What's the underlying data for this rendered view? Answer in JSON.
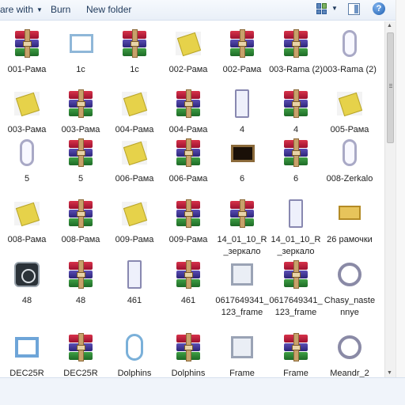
{
  "toolbar": {
    "share_label": "are with",
    "burn_label": "Burn",
    "new_folder_label": "New folder",
    "help_glyph": "?"
  },
  "files": [
    {
      "label": "001-Рама",
      "icon": "archive-icon"
    },
    {
      "label": "1c",
      "icon": "image-icon"
    },
    {
      "label": "1c",
      "icon": "archive-icon"
    },
    {
      "label": "002-Рама",
      "icon": "image-icon"
    },
    {
      "label": "002-Рама",
      "icon": "archive-icon"
    },
    {
      "label": "003-Rama (2)",
      "icon": "archive-icon"
    },
    {
      "label": "003-Rama (2)",
      "icon": "image-icon"
    },
    {
      "label": "003-Рама",
      "icon": "image-icon"
    },
    {
      "label": "003-Рама",
      "icon": "archive-icon"
    },
    {
      "label": "004-Рама",
      "icon": "image-icon"
    },
    {
      "label": "004-Рама",
      "icon": "archive-icon"
    },
    {
      "label": "4",
      "icon": "image-icon"
    },
    {
      "label": "4",
      "icon": "archive-icon"
    },
    {
      "label": "005-Рама",
      "icon": "image-icon"
    },
    {
      "label": "5",
      "icon": "image-icon"
    },
    {
      "label": "5",
      "icon": "archive-icon"
    },
    {
      "label": "006-Рама",
      "icon": "image-icon"
    },
    {
      "label": "006-Рама",
      "icon": "archive-icon"
    },
    {
      "label": "6",
      "icon": "image-icon"
    },
    {
      "label": "6",
      "icon": "archive-icon"
    },
    {
      "label": "008-Zerkalo",
      "icon": "image-icon"
    },
    {
      "label": "008-Рама",
      "icon": "image-icon"
    },
    {
      "label": "008-Рама",
      "icon": "archive-icon"
    },
    {
      "label": "009-Рама",
      "icon": "image-icon"
    },
    {
      "label": "009-Рама",
      "icon": "archive-icon"
    },
    {
      "label": "14_01_10_R_зеркало",
      "icon": "archive-icon"
    },
    {
      "label": "14_01_10_R_зеркало",
      "icon": "image-icon"
    },
    {
      "label": "26 рамочки",
      "icon": "image-icon"
    },
    {
      "label": "48",
      "icon": "image-icon"
    },
    {
      "label": "48",
      "icon": "archive-icon"
    },
    {
      "label": "461",
      "icon": "image-icon"
    },
    {
      "label": "461",
      "icon": "archive-icon"
    },
    {
      "label": "0617649341_123_frame",
      "icon": "image-icon"
    },
    {
      "label": "0617649341_123_frame",
      "icon": "archive-icon"
    },
    {
      "label": "Chasy_nastennye",
      "icon": "image-icon"
    },
    {
      "label": "DEC25R",
      "icon": "image-icon"
    },
    {
      "label": "DEC25R",
      "icon": "archive-icon"
    },
    {
      "label": "Dolphins",
      "icon": "image-icon"
    },
    {
      "label": "Dolphins",
      "icon": "archive-icon"
    },
    {
      "label": "Frame",
      "icon": "image-icon"
    },
    {
      "label": "Frame",
      "icon": "archive-icon"
    },
    {
      "label": "Meandr_2",
      "icon": "image-icon"
    }
  ]
}
